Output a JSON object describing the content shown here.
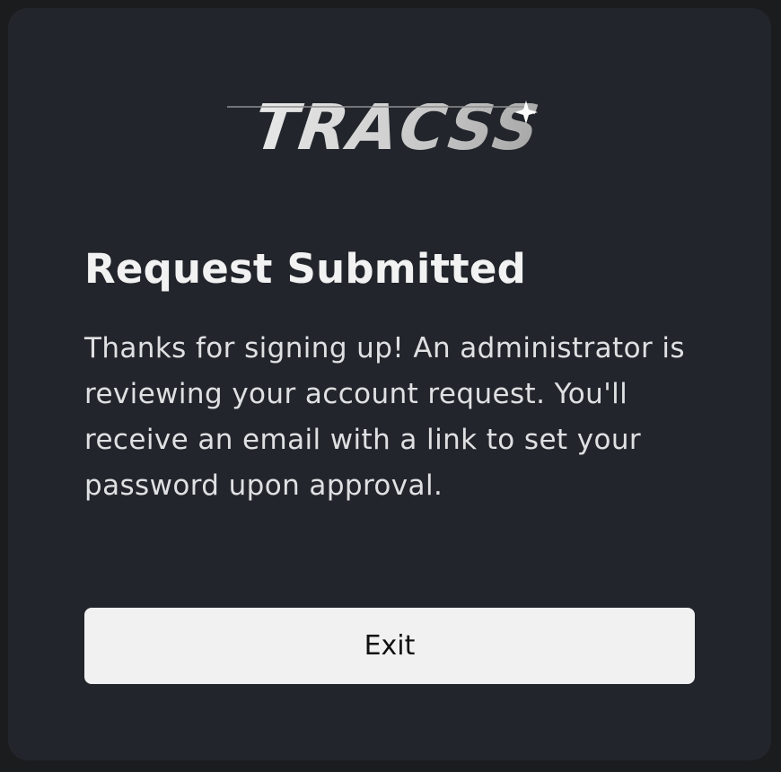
{
  "logo": {
    "text": "TRACSS",
    "icon": "sparkle-star-icon",
    "colors": {
      "primary": "#dedede",
      "secondary": "#b9b9b9"
    }
  },
  "dialog": {
    "title": "Request Submitted",
    "message": "Thanks for signing up! An administrator is reviewing your account request. You'll receive an email with a link to set your password upon approval.",
    "exit_label": "Exit"
  },
  "colors": {
    "page_background": "#1b1c1e",
    "card_background": "#22262c",
    "button_background": "#f1f1f1",
    "title_text": "#f2f2f2",
    "body_text": "#dfe0e2"
  }
}
